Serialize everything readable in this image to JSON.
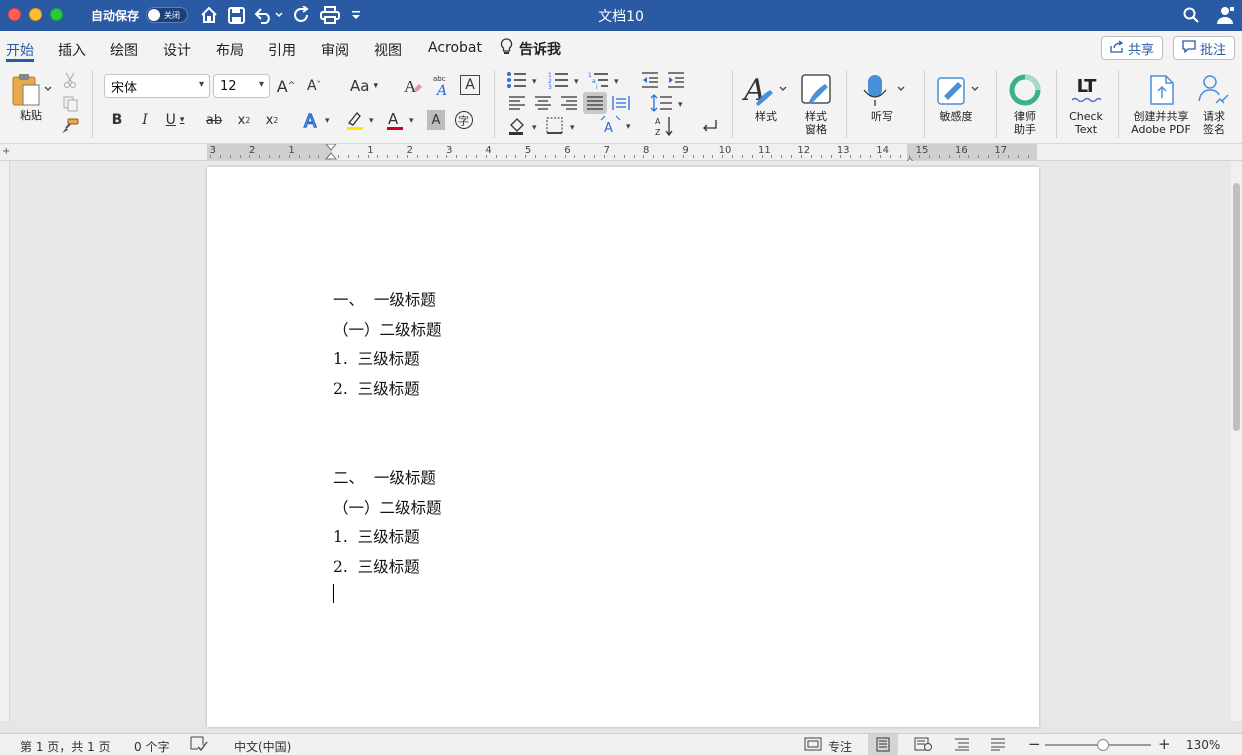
{
  "window": {
    "title": "文档10",
    "autosave_label": "自动保存",
    "autosave_state": "关闭"
  },
  "titlebar_icons": [
    "home-icon",
    "save-icon",
    "undo-icon",
    "redo-icon",
    "print-icon",
    "customize-icon",
    "search-icon",
    "account-icon"
  ],
  "menu": {
    "tabs": [
      "开始",
      "插入",
      "绘图",
      "设计",
      "布局",
      "引用",
      "审阅",
      "视图",
      "Acrobat"
    ],
    "active_tab": "开始",
    "tell_me": "告诉我",
    "share_label": "共享",
    "comment_label": "批注"
  },
  "ribbon": {
    "paste_label": "粘贴",
    "font_name": "宋体",
    "font_size": "12",
    "styles_label": "样式",
    "styles_pane_label": "样式\n窗格",
    "dictate_label": "听写",
    "sensitivity_label": "敏感度",
    "lawyer_label": "律师\n助手",
    "check_text_label": "Check\nText",
    "lt_logo": "LT",
    "create_pdf_label": "创建并共享\nAdobe PDF",
    "request_sign_label": "请求\n签名"
  },
  "ruler": {
    "left_numbers": [
      "3",
      "2",
      "1"
    ],
    "right_numbers": [
      "1",
      "2",
      "3",
      "4",
      "5",
      "6",
      "7",
      "8",
      "9",
      "10",
      "11",
      "12",
      "13",
      "14",
      "15",
      "16",
      "17"
    ]
  },
  "document": {
    "paragraphs": [
      "一、  一级标题",
      "（一）二级标题",
      "1.  三级标题",
      "2.  三级标题",
      "",
      "",
      "二、  一级标题",
      "（一）二级标题",
      "1.  三级标题",
      "2.  三级标题"
    ]
  },
  "status": {
    "page_info": "第 1 页，共 1 页",
    "word_count": "0 个字",
    "language": "中文(中国)",
    "focus_label": "专注",
    "zoom": "130%",
    "zoom_slider_fraction": 0.55
  },
  "colors": {
    "titlebar": "#2b5aa5",
    "accent": "#2b5aa5",
    "ribbon_bg": "#f3f3f3"
  }
}
